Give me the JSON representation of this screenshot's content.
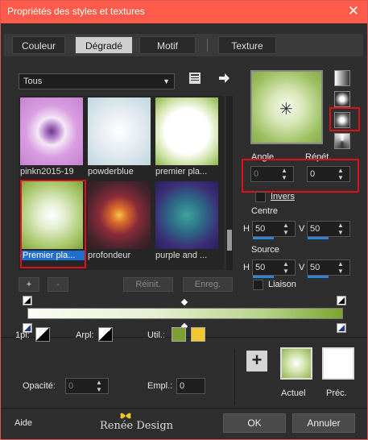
{
  "window": {
    "title": "Propriétés des styles et textures",
    "close": "✕"
  },
  "tabs": [
    {
      "label": "Couleur"
    },
    {
      "label": "Dégradé",
      "active": true
    },
    {
      "label": "Motif"
    },
    {
      "label": "Texture"
    }
  ],
  "category": {
    "value": "Tous"
  },
  "gradients": [
    {
      "label": "pinkn2015-19"
    },
    {
      "label": "powderblue"
    },
    {
      "label": "premier pla..."
    },
    {
      "label": "Premier pla...",
      "selected": true
    },
    {
      "label": "profondeur"
    },
    {
      "label": "purple and ..."
    }
  ],
  "list_buttons": {
    "add": "+",
    "remove": "-",
    "reset": "Réinit.",
    "save": "Enreg."
  },
  "style": {
    "angle_label": "Angle",
    "angle_value": "0",
    "repeat_label": "Répét.",
    "repeat_value": "0",
    "invert_label": "Invers",
    "center_label": "Centre",
    "center_h_label": "H",
    "center_h": "50",
    "center_v_label": "V",
    "center_v": "50",
    "source_label": "Source",
    "source_h_label": "H",
    "source_h": "50",
    "source_v_label": "V",
    "source_v": "50",
    "link_label": "Liaison"
  },
  "bottom": {
    "p1_label": "1pl:",
    "arpl_label": "Arpl:",
    "util_label": "Util.:",
    "opacity_label": "Opacité:",
    "opacity_value": "0",
    "empl_label": "Empl.:",
    "empl_value": "0",
    "current_label": "Actuel",
    "previous_label": "Préc.",
    "add_label": "+"
  },
  "colors": {
    "util_green": "#7e9e36",
    "util_yellow": "#f2c72e",
    "title_bar": "#ff5b4a",
    "highlight": "#e0101a",
    "selected_label_bg": "#1e6fd0"
  },
  "footer": {
    "help": "Aide",
    "watermark": "Renée Design",
    "ok": "OK",
    "cancel": "Annuler"
  },
  "icons": [
    "close-icon",
    "dropdown-arrow-icon",
    "gradient-editor-icon",
    "arrow-right-icon",
    "style-linear-icon",
    "style-rectangular-icon",
    "style-radial-icon",
    "style-sunburst-icon",
    "butterfly-icon"
  ]
}
